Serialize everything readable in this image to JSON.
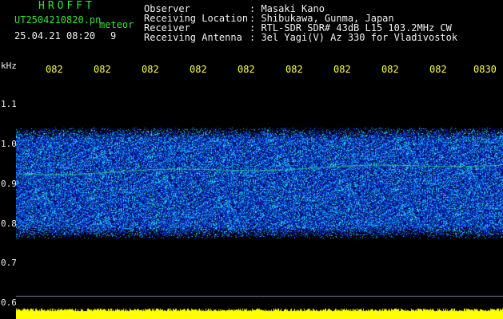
{
  "header": {
    "app_title": "HROFFT",
    "file_name": "UT2504210820.pn",
    "meteor_label": "meteor",
    "date_time": "25.04.21 08:20",
    "meteor_count": "9"
  },
  "info": [
    {
      "label": "Observer",
      "value": ": Masaki Kano"
    },
    {
      "label": "Receiving Location",
      "value": ": Shibukawa, Gunma, Japan"
    },
    {
      "label": "Receiver",
      "value": ": RTL-SDR SDR# 43dB L15 103.2MHz CW"
    },
    {
      "label": "Receiving Antenna",
      "value": ": 3el Yagi(V) Az 330 for Vladivostok"
    }
  ],
  "axis": {
    "freq_unit": "kHz",
    "freq_ticks": [
      "1.1",
      "1.0",
      "0.9",
      "0.8",
      "0.7",
      "0.6"
    ],
    "time_ticks": [
      "082",
      "082",
      "082",
      "082",
      "082",
      "082",
      "082",
      "082",
      "082",
      "0830"
    ]
  },
  "colors": {
    "background": "#000000",
    "label_green": "#32e632",
    "label_white": "#f0f0f0",
    "tick_yellow": "#ffff40",
    "noise_blue": "#1e3cff",
    "noise_cyan": "#30c8ff",
    "signal_green": "#40ff80",
    "baseline_yellow": "#ffff00"
  }
}
